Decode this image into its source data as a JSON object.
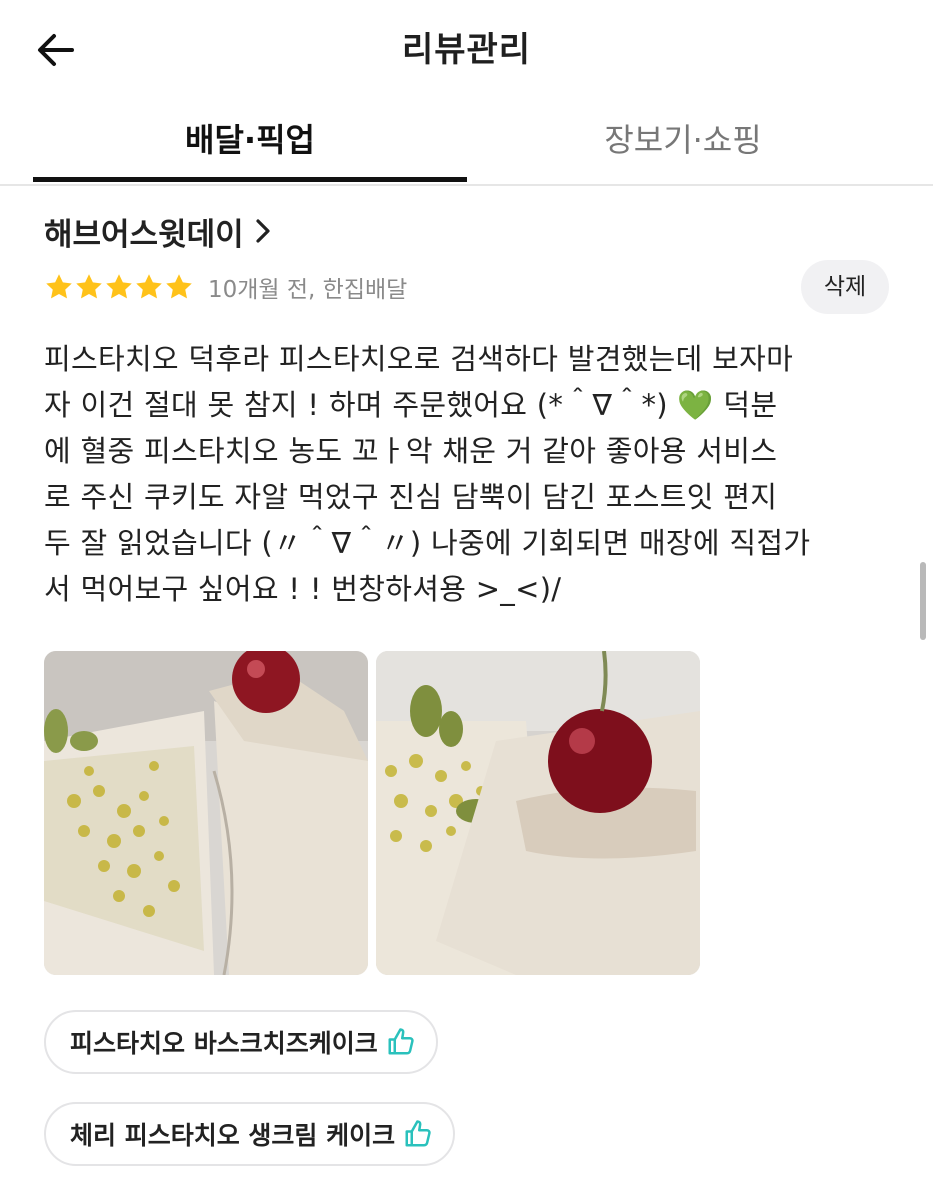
{
  "header": {
    "title": "리뷰관리",
    "back_icon": "arrow-left-icon"
  },
  "tabs": [
    {
      "label": "배달·픽업",
      "active": true
    },
    {
      "label": "장보기·쇼핑",
      "active": false
    }
  ],
  "review": {
    "store_name": "해브어스윗데이",
    "rating": 5,
    "max_rating": 5,
    "meta": "10개월 전, 한집배달",
    "delete_label": "삭제",
    "text": "피스타치오 덕후라 피스타치오로 검색하다 발견했는데 보자마\n자 이건 절대 못 참지 ! 하며 주문했어요 (*＾∇＾*) 💚 덕분\n에 혈중 피스타치오 농도 꼬ㅏ악 채운 거 같아 좋아용 서비스\n로 주신 쿠키도 자알 먹었구 진심 담뿍이 담긴 포스트잇 편지\n두 잘 읽었습니다 (〃＾∇＾〃) 나중에 기회되면 매장에 직접가\n서 먹어보구 싶어요 ! ! 번창하셔용 >_<)/",
    "photos": [
      "pistachio-cake-slice-photo",
      "cherry-pistachio-cake-photo"
    ],
    "menu_items": [
      {
        "label": "피스타치오 바스크치즈케이크",
        "icon": "thumbs-up-icon"
      },
      {
        "label": "체리 피스타치오 생크림 케이크",
        "icon": "thumbs-up-icon"
      }
    ]
  },
  "colors": {
    "star": "#ffc21a",
    "thumb_icon": "#2ac1bc",
    "meta_text": "#8a8a8a",
    "delete_bg": "#f1f1f3"
  }
}
